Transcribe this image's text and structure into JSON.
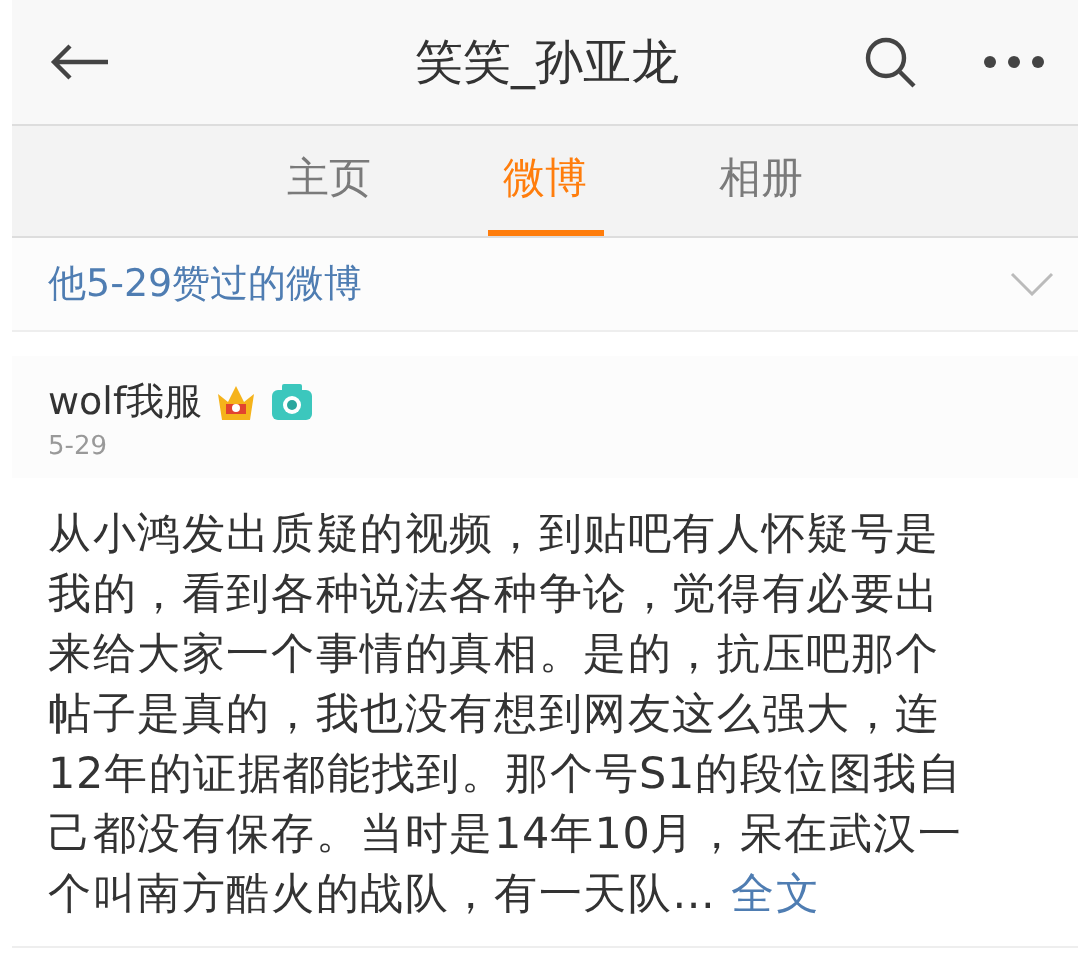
{
  "header": {
    "title": "笑笑_孙亚龙"
  },
  "tabs": [
    {
      "label": "主页",
      "selected": false
    },
    {
      "label": "微博",
      "selected": true
    },
    {
      "label": "相册",
      "selected": false
    }
  ],
  "filter": {
    "label": "他5-29赞过的微博",
    "expanded": false
  },
  "post": {
    "author": "wolf我服",
    "date": "5-29",
    "text": "从小鸿发出质疑的视频，到贴吧有人怀疑号是我的，看到各种说法各种争论，觉得有必要出来给大家一个事情的真相。是的，抗压吧那个帖子是真的，我也没有想到网友这么强大，连12年的证据都能找到。那个号S1的段位图我自己都没有保存。当时是14年10月，呆在武汉一个叫南方酷火的战队，有一天队...",
    "more_link": "全文"
  }
}
